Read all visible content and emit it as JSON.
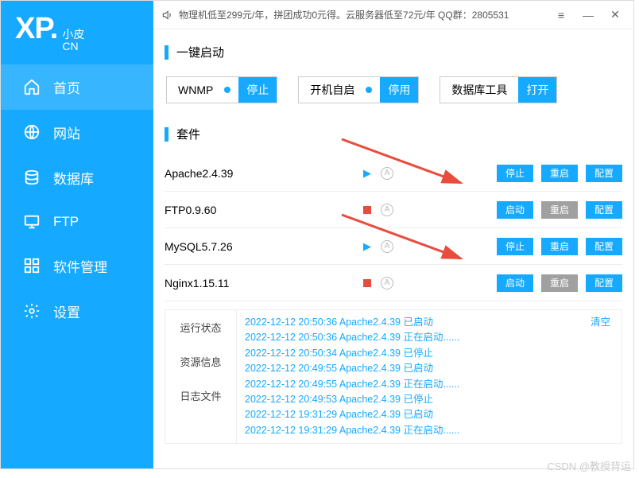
{
  "logo": {
    "main": "XP.",
    "sub1": "小皮",
    "sub2": "CN"
  },
  "titlebar": {
    "announce": "物理机低至299元/年，拼团成功0元得。云服务器低至72元/年   QQ群：2805531"
  },
  "nav": [
    {
      "label": "首页"
    },
    {
      "label": "网站"
    },
    {
      "label": "数据库"
    },
    {
      "label": "FTP"
    },
    {
      "label": "软件管理"
    },
    {
      "label": "设置"
    }
  ],
  "quick": {
    "title": "一键启动",
    "wnmp": {
      "label": "WNMP",
      "btn": "停止"
    },
    "boot": {
      "label": "开机自启",
      "btn": "停用"
    },
    "db": {
      "label": "数据库工具",
      "btn": "打开"
    }
  },
  "suite": {
    "title": "套件",
    "items": [
      {
        "name": "Apache2.4.39",
        "running": true,
        "b1": "停止",
        "b2": "重启",
        "b2grey": false,
        "b3": "配置"
      },
      {
        "name": "FTP0.9.60",
        "running": false,
        "b1": "启动",
        "b2": "重启",
        "b2grey": true,
        "b3": "配置"
      },
      {
        "name": "MySQL5.7.26",
        "running": true,
        "b1": "停止",
        "b2": "重启",
        "b2grey": false,
        "b3": "配置"
      },
      {
        "name": "Nginx1.15.11",
        "running": false,
        "b1": "启动",
        "b2": "重启",
        "b2grey": true,
        "b3": "配置"
      }
    ]
  },
  "logs": {
    "tabs": [
      "运行状态",
      "资源信息",
      "日志文件"
    ],
    "clear": "清空",
    "lines": [
      "2022-12-12 20:50:36 Apache2.4.39 已启动",
      "2022-12-12 20:50:36 Apache2.4.39 正在启动......",
      "2022-12-12 20:50:34 Apache2.4.39 已停止",
      "2022-12-12 20:49:55 Apache2.4.39 已启动",
      "2022-12-12 20:49:55 Apache2.4.39 正在启动......",
      "2022-12-12 20:49:53 Apache2.4.39 已停止",
      "2022-12-12 19:31:29 Apache2.4.39 已启动",
      "2022-12-12 19:31:29 Apache2.4.39 正在启动......"
    ]
  },
  "watermark": "CSDN @教授背运"
}
